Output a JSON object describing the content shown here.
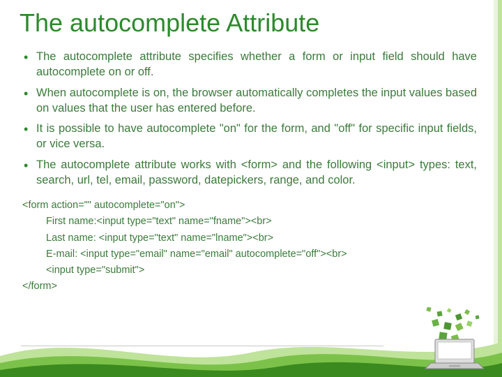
{
  "title": "The autocomplete Attribute",
  "bullets": [
    "The autocomplete attribute specifies whether a form or input field should have autocomplete on or off.",
    "When autocomplete is on, the browser automatically completes the input values based on values that the user has entered before.",
    "It is possible to have autocomplete \"on\" for the form, and \"off\" for specific input fields, or vice versa.",
    "The autocomplete attribute works with <form> and the following <input> types: text, search, url, tel, email, password, datepickers, range, and color."
  ],
  "code": {
    "line0": "<form action=\"\" autocomplete=\"on\">",
    "line1": "First name:<input type=\"text\" name=\"fname\"><br>",
    "line2": "Last name: <input type=\"text\" name=\"lname\"><br>",
    "line3": "E-mail: <input type=\"email\" name=\"email\" autocomplete=\"off\"><br>",
    "line4": "<input type=\"submit\">",
    "line5": "</form>"
  },
  "colors": {
    "accent": "#2d8a2d",
    "text": "#3a7a3a",
    "wave_light": "#9ed36a",
    "wave_dark": "#3a8a1f"
  }
}
